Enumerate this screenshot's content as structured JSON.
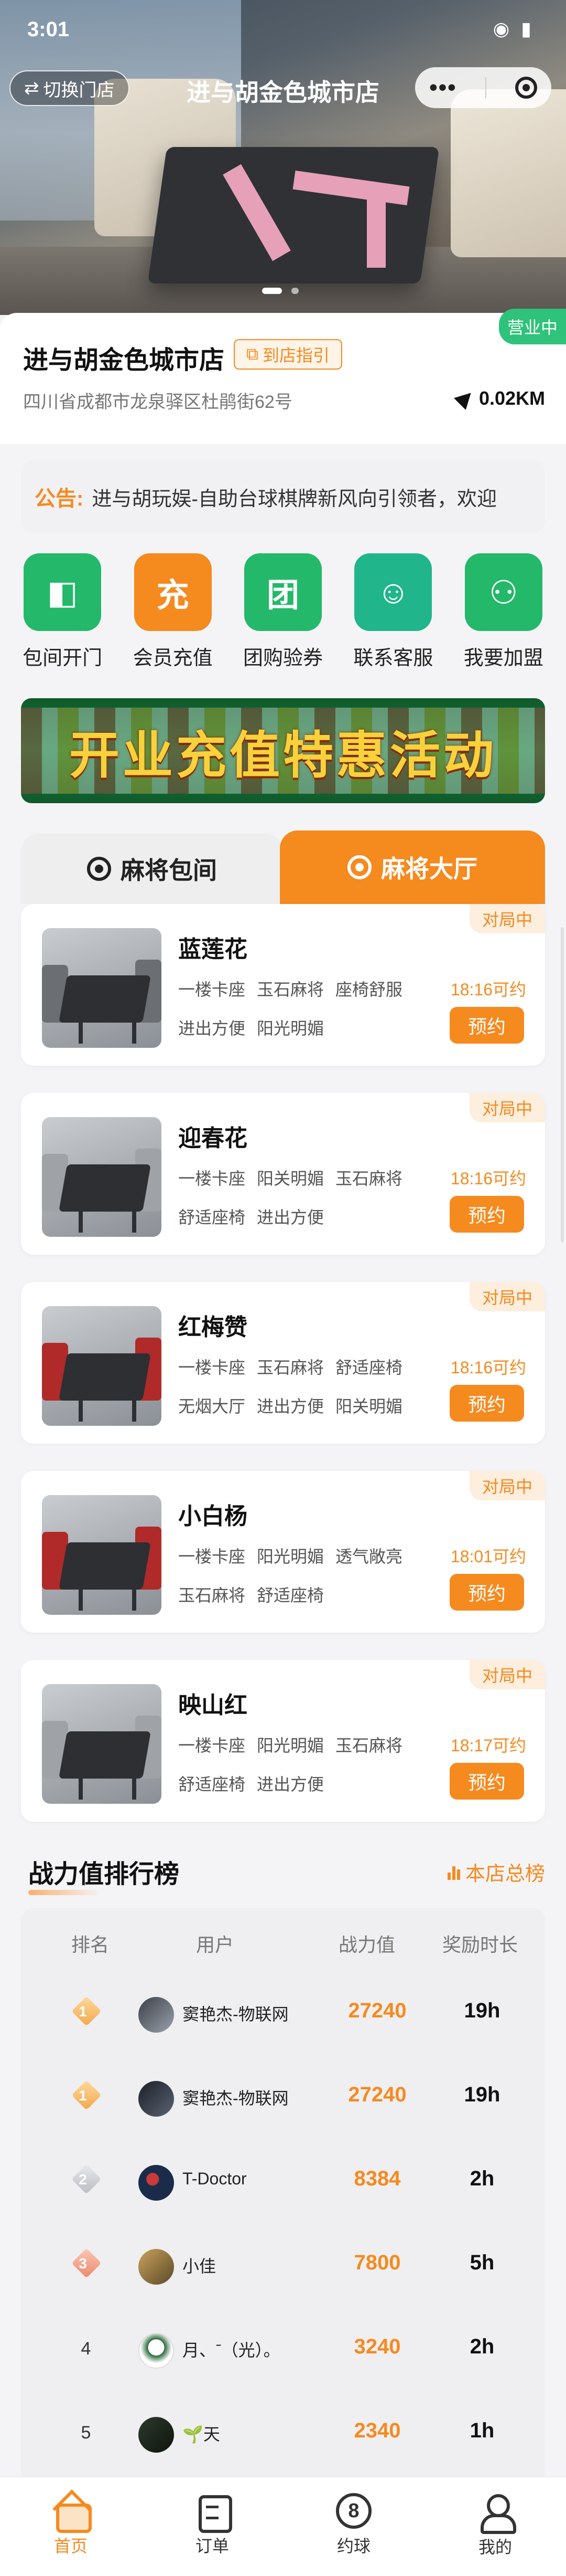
{
  "status_bar": {
    "time": "3:01",
    "icons": "◉ ▮"
  },
  "header": {
    "switch_store": "切换门店",
    "switch_icon": "⇄",
    "title": "进与胡金色城市店",
    "more_icon": "•••"
  },
  "store": {
    "open_status": "营业中",
    "name": "进与胡金色城市店",
    "nav_guide": "到店指引",
    "address": "四川省成都市龙泉驿区杜鹃街62号",
    "distance": "0.02KM"
  },
  "notice": {
    "label": "公告:",
    "text": "进与胡玩娱-自助台球棋牌新风向引领者，欢迎"
  },
  "actions": [
    {
      "label": "包间开门",
      "icon": "door-icon",
      "glyph": "◧"
    },
    {
      "label": "会员充值",
      "icon": "recharge-icon",
      "glyph": "充"
    },
    {
      "label": "团购验券",
      "icon": "group-buy-icon",
      "glyph": "团"
    },
    {
      "label": "联系客服",
      "icon": "headset-icon",
      "glyph": "☺"
    },
    {
      "label": "我要加盟",
      "icon": "partners-icon",
      "glyph": "⚇"
    }
  ],
  "banner": {
    "text": "开业充值特惠活动"
  },
  "tabs": {
    "private": "麻将包间",
    "hall": "麻将大厅"
  },
  "rooms": [
    {
      "name": "蓝莲花",
      "status": "对局中",
      "tags1": [
        "一楼卡座",
        "玉石麻将",
        "座椅舒服"
      ],
      "tags2": [
        "进出方便",
        "阳光明媚"
      ],
      "available": "18:16可约",
      "book": "预约"
    },
    {
      "name": "迎春花",
      "status": "对局中",
      "tags1": [
        "一楼卡座",
        "阳关明媚",
        "玉石麻将"
      ],
      "tags2": [
        "舒适座椅",
        "进出方便"
      ],
      "available": "18:16可约",
      "book": "预约"
    },
    {
      "name": "红梅赞",
      "status": "对局中",
      "tags1": [
        "一楼卡座",
        "玉石麻将",
        "舒适座椅"
      ],
      "tags2": [
        "无烟大厅",
        "进出方便",
        "阳关明媚"
      ],
      "available": "18:16可约",
      "book": "预约"
    },
    {
      "name": "小白杨",
      "status": "对局中",
      "tags1": [
        "一楼卡座",
        "阳光明媚",
        "透气敞亮"
      ],
      "tags2": [
        "玉石麻将",
        "舒适座椅"
      ],
      "available": "18:01可约",
      "book": "预约"
    },
    {
      "name": "映山红",
      "status": "对局中",
      "tags1": [
        "一楼卡座",
        "阳光明媚",
        "玉石麻将"
      ],
      "tags2": [
        "舒适座椅",
        "进出方便"
      ],
      "available": "18:17可约",
      "book": "预约"
    }
  ],
  "ranking": {
    "title": "战力值排行榜",
    "total_link": "本店总榜",
    "columns": {
      "rank": "排名",
      "user": "用户",
      "power": "战力值",
      "reward": "奖励时长"
    },
    "rows": [
      {
        "rank": "1",
        "user": "窦艳杰-物联网",
        "power": "27240",
        "reward": "19h"
      },
      {
        "rank": "1",
        "user": "窦艳杰-物联网",
        "power": "27240",
        "reward": "19h"
      },
      {
        "rank": "2",
        "user": "T-Doctor",
        "power": "8384",
        "reward": "2h"
      },
      {
        "rank": "3",
        "user": "小佳",
        "power": "7800",
        "reward": "5h"
      },
      {
        "rank": "4",
        "user": "月、ˉ（光）。",
        "power": "3240",
        "reward": "2h"
      },
      {
        "rank": "5",
        "user": "🌱天",
        "power": "2340",
        "reward": "1h"
      }
    ]
  },
  "tabbar": [
    {
      "label": "首页",
      "icon": "home-icon",
      "active": true
    },
    {
      "label": "订单",
      "icon": "order-icon",
      "active": false
    },
    {
      "label": "约球",
      "icon": "ball-icon",
      "glyph": "8",
      "active": false
    },
    {
      "label": "我的",
      "icon": "profile-icon",
      "active": false
    }
  ],
  "colors": {
    "accent": "#f58a1f",
    "green": "#24b86a",
    "open": "#2fc27a"
  }
}
